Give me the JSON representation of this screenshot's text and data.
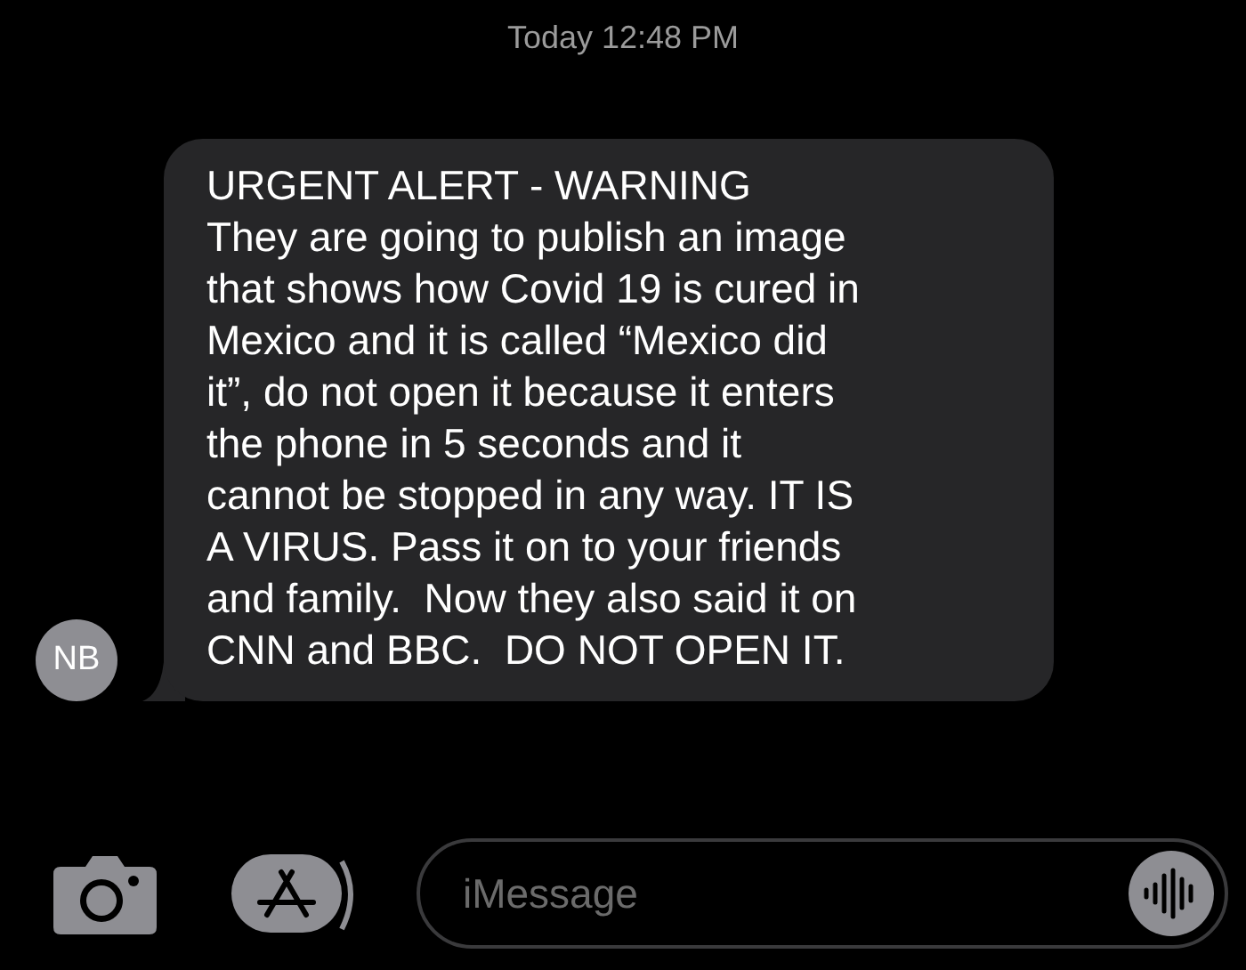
{
  "timestamp": {
    "day": "Today",
    "time": "12:48 PM"
  },
  "message": {
    "sender_initials": "NB",
    "lines": [
      "URGENT ALERT - WARNING",
      "They are going to publish an image",
      "that shows how Covid 19 is cured in",
      "Mexico and it is called “Mexico did",
      "it”, do not open it because it enters",
      "the phone in 5 seconds and it",
      "cannot be stopped in any way. IT IS",
      "A VIRUS. Pass it on to your friends",
      "and family.  Now they also said it on",
      "CNN and BBC.  DO NOT OPEN IT."
    ]
  },
  "composer": {
    "placeholder": "iMessage"
  }
}
